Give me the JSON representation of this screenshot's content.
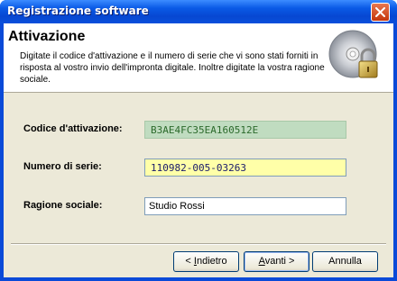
{
  "window": {
    "title": "Registrazione software"
  },
  "header": {
    "title": "Attivazione",
    "description": "Digitate il codice d'attivazione e il numero di serie che vi sono stati forniti in risposta al vostro invio dell'impronta digitale. Inoltre digitate la vostra ragione sociale."
  },
  "fields": {
    "activation": {
      "label": "Codice d'attivazione:",
      "value": "B3AE4FC35EA160512E"
    },
    "serial": {
      "label": "Numero di serie:",
      "value": "110982-005-03263"
    },
    "company": {
      "label": "Ragione sociale:",
      "value": "Studio Rossi"
    }
  },
  "buttons": {
    "back": {
      "prefix": "< ",
      "mnemonic": "I",
      "rest": "ndietro"
    },
    "next": {
      "mnemonic": "A",
      "rest": "vanti >"
    },
    "cancel": "Annulla"
  },
  "icons": {
    "close": "close-icon",
    "header": "cd-lock-icon"
  },
  "colors": {
    "titlebar": "#0a5ae6",
    "activation_bg": "#c0dcc0",
    "serial_bg": "#ffffa8"
  }
}
